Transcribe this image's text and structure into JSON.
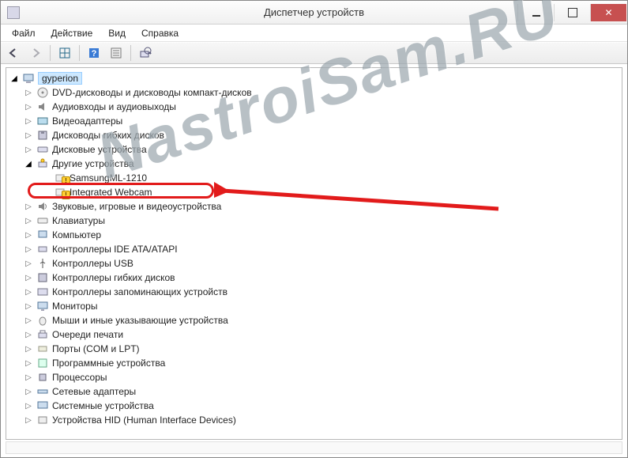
{
  "window": {
    "title": "Диспетчер устройств"
  },
  "menu": {
    "file": "Файл",
    "action": "Действие",
    "view": "Вид",
    "help": "Справка"
  },
  "watermark": "NastroiSam.RU",
  "tree": {
    "root": "gyperion",
    "dvd": "DVD-дисководы и дисководы компакт-дисков",
    "audio": "Аудиовходы и аудиовыходы",
    "video": "Видеоадаптеры",
    "floppy_drives": "Дисководы гибких дисков",
    "disk_drives": "Дисковые устройства",
    "other": "Другие устройства",
    "other_child1": "SamsungML-1210",
    "other_child2": "Integrated Webcam",
    "sound": "Звуковые, игровые и видеоустройства",
    "keyboards": "Клавиатуры",
    "computer": "Компьютер",
    "ide": "Контроллеры IDE ATA/ATAPI",
    "usb": "Контроллеры USB",
    "floppy_ctrl": "Контроллеры гибких дисков",
    "storage_ctrl": "Контроллеры запоминающих устройств",
    "monitors": "Мониторы",
    "mice": "Мыши и иные указывающие устройства",
    "print_queues": "Очереди печати",
    "ports": "Порты (COM и LPT)",
    "software_dev": "Программные устройства",
    "processors": "Процессоры",
    "network": "Сетевые адаптеры",
    "system": "Системные устройства",
    "hid": "Устройства HID (Human Interface Devices)"
  }
}
